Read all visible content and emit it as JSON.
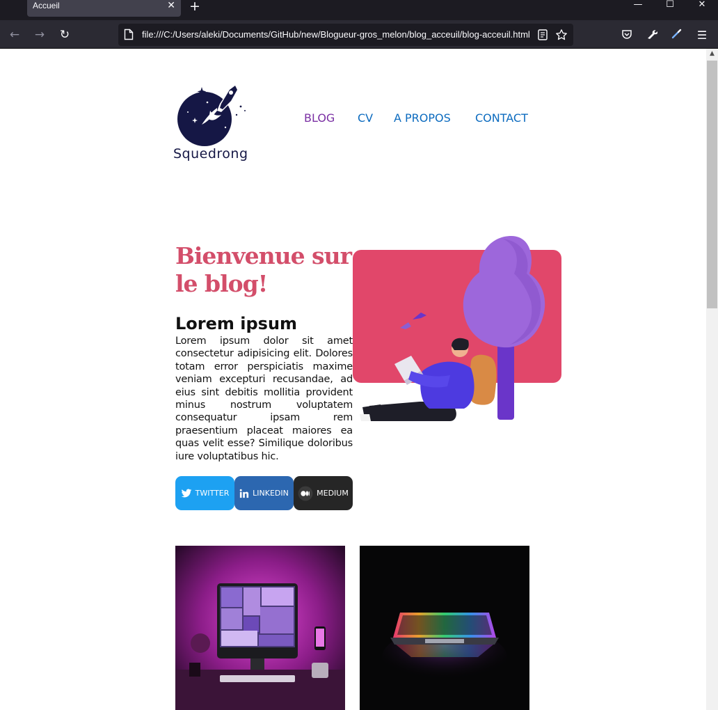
{
  "browser": {
    "tab_title": "Accueil",
    "tab_close": "✕",
    "new_tab": "+",
    "window_controls": {
      "minimize": "—",
      "maximize": "☐",
      "close": "✕"
    },
    "url": "file:///C:/Users/aleki/Documents/GitHub/new/Blogueur-gros_melon/blog_acceuil/blog-acceuil.html",
    "icons": [
      "back-arrow-icon",
      "forward-arrow-icon",
      "reload-icon",
      "page-icon",
      "reader-view-icon",
      "bookmark-star-icon",
      "pocket-icon",
      "wrench-icon",
      "eyedropper-icon",
      "menu-icon"
    ]
  },
  "site": {
    "logo_text": "Squedrong",
    "nav": [
      {
        "label": "BLOG",
        "active": true
      },
      {
        "label": "CV",
        "active": false
      },
      {
        "label": "A PROPOS",
        "active": false
      },
      {
        "label": "CONTACT",
        "active": false
      }
    ],
    "hero": {
      "title": "Bienvenue sur le blog!",
      "subtitle": "Lorem ipsum",
      "body": "Lorem ipsum dolor sit amet consectetur adipisicing elit. Dolores totam error perspiciatis maxime veniam excepturi recusandae, ad eius sint debitis mollitia provident minus nostrum voluptatem consequatur ipsam rem praesentium placeat maiores ea quas velit esse? Similique doloribus iure voluptatibus hic."
    },
    "social": [
      {
        "label": "TWITTER",
        "icon": "twitter-bird-icon",
        "color": "#1da1f2"
      },
      {
        "label": "LINKEDIN",
        "icon": "linkedin-icon",
        "color": "#2c67b0"
      },
      {
        "label": "MEDIUM",
        "icon": "medium-icon",
        "color": "#262626"
      }
    ],
    "colors": {
      "accent": "#d34e6a",
      "nav_link": "#0c6bbf",
      "nav_active": "#7a2fa3",
      "logo": "#151745"
    }
  }
}
